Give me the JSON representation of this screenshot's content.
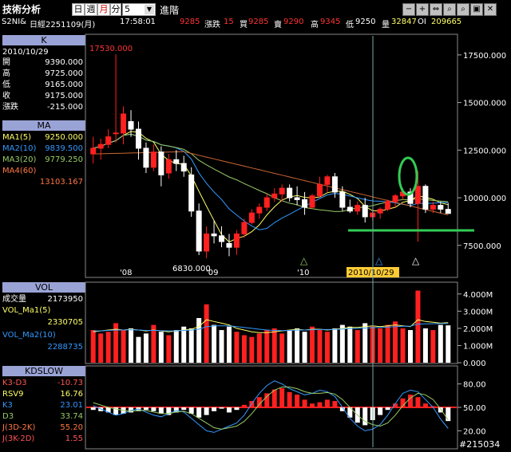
{
  "toolbar": {
    "title": "技術分析",
    "period_buttons": [
      "日",
      "週",
      "月",
      "分"
    ],
    "active_period": "月",
    "interval_value": "5",
    "advanced_label": "進階",
    "window_buttons": [
      "−",
      "+",
      "⇔",
      "⌕",
      "⌕",
      "▣",
      "✕"
    ]
  },
  "quote": {
    "symbol": "S2NI&",
    "name": "日經2251109(月)",
    "time": "17:58:01",
    "price": "9285",
    "change_label": "漲跌",
    "change_value": "15",
    "bid_label": "買",
    "bid_value": "9285",
    "ask_label": "賣",
    "ask_value": "9290",
    "high_label": "高",
    "high_value": "9345",
    "low_label": "低",
    "low_value": "9250",
    "volume_label": "量",
    "volume_value": "32847",
    "oi_label": "OI",
    "oi_value": "209665"
  },
  "k_panel": {
    "header": "K",
    "date": "2010/10/29",
    "rows": [
      {
        "label": "開",
        "value": "9390.000"
      },
      {
        "label": "高",
        "value": "9725.000"
      },
      {
        "label": "低",
        "value": "9165.000"
      },
      {
        "label": "收",
        "value": "9175.000"
      },
      {
        "label": "漲跌",
        "value": "-215.000"
      }
    ]
  },
  "ma_panel": {
    "header": "MA",
    "rows": [
      {
        "label": "MA1(5)",
        "value": "9250.000",
        "color": "#ffff66"
      },
      {
        "label": "MA2(10)",
        "value": "9839.500",
        "color": "#3399ff"
      },
      {
        "label": "MA3(20)",
        "value": "9779.250",
        "color": "#99cc66"
      },
      {
        "label": "MA4(60)",
        "value": "13103.167",
        "color": "#ff7744"
      }
    ]
  },
  "vol_panel": {
    "header": "VOL",
    "rows": [
      {
        "label": "成交量",
        "value": "2173950",
        "color": "#ffffff"
      },
      {
        "label": "VOL_Ma1(5)",
        "value": "2330705",
        "color": "#ffff66"
      },
      {
        "label": "VOL_Ma2(10)",
        "value": "2288735",
        "color": "#3399ff"
      }
    ]
  },
  "kd_panel": {
    "header": "KDSLOW",
    "rows": [
      {
        "label": "K3-D3",
        "value": "-10.73",
        "color": "#ff5555"
      },
      {
        "label": "RSV9",
        "value": "16.76",
        "color": "#ffff66"
      },
      {
        "label": "K3",
        "value": "23.01",
        "color": "#3399ff"
      },
      {
        "label": "D3",
        "value": "33.74",
        "color": "#99cc66"
      },
      {
        "label": "J(3D-2K)",
        "value": "55.20",
        "color": "#ff7744"
      },
      {
        "label": "J(3K-2D)",
        "value": "1.55",
        "color": "#ff5555"
      }
    ]
  },
  "chart_data": [
    {
      "type": "candlestick",
      "title": "",
      "y_ticks": [
        "17500.000",
        "15000.000",
        "12500.000",
        "10000.000",
        "7500.000"
      ],
      "ylim": [
        5900,
        18500
      ],
      "x_ticks": [
        "'08",
        "'09",
        "'10"
      ],
      "cursor_date": "2010/10/29",
      "annotations": {
        "high_marker": "17530.000",
        "low_marker": "6830.000"
      },
      "candles": [
        [
          12300,
          13200,
          11800,
          12600
        ],
        [
          12600,
          13100,
          12000,
          12800
        ],
        [
          12800,
          13600,
          12600,
          13200
        ],
        [
          13400,
          17530,
          12900,
          13400
        ],
        [
          13400,
          14800,
          12800,
          14400
        ],
        [
          14000,
          14600,
          13200,
          13600
        ],
        [
          13600,
          14000,
          12000,
          12600
        ],
        [
          12600,
          12900,
          11300,
          11600
        ],
        [
          11600,
          12800,
          11400,
          12400
        ],
        [
          12400,
          12700,
          10600,
          11200
        ],
        [
          11300,
          12300,
          11000,
          12000
        ],
        [
          12000,
          12500,
          11400,
          11800
        ],
        [
          11800,
          12200,
          11100,
          11400
        ],
        [
          11200,
          11600,
          9000,
          9300
        ],
        [
          9300,
          9700,
          6990,
          7200
        ],
        [
          7200,
          8500,
          6830,
          8100
        ],
        [
          8100,
          8800,
          7600,
          8000
        ],
        [
          8000,
          8500,
          7400,
          7700
        ],
        [
          7600,
          8100,
          6930,
          7400
        ],
        [
          7400,
          8300,
          7000,
          8100
        ],
        [
          8100,
          8900,
          7900,
          8700
        ],
        [
          8700,
          9400,
          8600,
          9200
        ],
        [
          9200,
          9700,
          8900,
          9500
        ],
        [
          9500,
          10200,
          9300,
          10000
        ],
        [
          10000,
          10500,
          9800,
          10200
        ],
        [
          10200,
          10700,
          9800,
          10500
        ],
        [
          10500,
          10700,
          9800,
          10000
        ],
        [
          10000,
          10600,
          9600,
          9900
        ],
        [
          9900,
          10300,
          9100,
          9500
        ],
        [
          9500,
          10200,
          9400,
          10100
        ],
        [
          10100,
          11100,
          10000,
          10700
        ],
        [
          10700,
          11200,
          10300,
          11100
        ],
        [
          11100,
          11300,
          10000,
          10300
        ],
        [
          10300,
          10600,
          9300,
          9500
        ],
        [
          9500,
          9900,
          9200,
          9300
        ],
        [
          9300,
          9800,
          9100,
          9600
        ],
        [
          9600,
          10000,
          8700,
          9000
        ],
        [
          9000,
          9400,
          8800,
          9200
        ],
        [
          9200,
          9500,
          8900,
          9400
        ],
        [
          9400,
          9900,
          9300,
          9800
        ],
        [
          9800,
          10200,
          9500,
          10100
        ],
        [
          10100,
          10500,
          9900,
          10300
        ],
        [
          10300,
          10500,
          9500,
          9700
        ],
        [
          9700,
          11400,
          7700,
          10600
        ],
        [
          10600,
          10700,
          9200,
          9400
        ],
        [
          9400,
          9800,
          9200,
          9600
        ],
        [
          9600,
          9800,
          9200,
          9400
        ],
        [
          9390,
          9725,
          9165,
          9175
        ]
      ],
      "marker_labels": [
        "△",
        "△",
        "△"
      ]
    },
    {
      "type": "bar",
      "title": "VOL",
      "y_ticks": [
        "4.000M",
        "3.000M",
        "2.000M",
        "1.000M",
        "0.000"
      ],
      "ylim": [
        0,
        4500000
      ],
      "values": [
        1900000,
        1700000,
        1800000,
        2300000,
        1900000,
        2000000,
        1500000,
        1700000,
        2200000,
        1800000,
        1600000,
        1900000,
        2100000,
        2000000,
        2600000,
        3400000,
        2200000,
        1900000,
        2100000,
        1800000,
        1600000,
        1500000,
        1700000,
        1900000,
        2000000,
        1700000,
        1900000,
        2000000,
        1800000,
        2100000,
        1900000,
        1800000,
        2000000,
        2200000,
        2100000,
        1900000,
        2300000,
        2100000,
        2000000,
        2200000,
        2400000,
        2000000,
        1900000,
        4200000,
        2000000,
        1900000,
        2200000,
        2173950
      ],
      "ma1": [
        1800000,
        1850000,
        1900000,
        1950000,
        1900000,
        1950000,
        1900000,
        1850000,
        1900000,
        1850000,
        1800000,
        1850000,
        1900000,
        1950000,
        2100000,
        2500000,
        2400000,
        2300000,
        2200000,
        2000000,
        1900000,
        1800000,
        1750000,
        1750000,
        1800000,
        1850000,
        1900000,
        1950000,
        1900000,
        1950000,
        1950000,
        1900000,
        1950000,
        2000000,
        2050000,
        2050000,
        2100000,
        2150000,
        2100000,
        2150000,
        2200000,
        2150000,
        2100000,
        2500000,
        2400000,
        2350000,
        2300000,
        2330705
      ],
      "ma2": [
        1850000,
        1850000,
        1880000,
        1900000,
        1900000,
        1920000,
        1900000,
        1880000,
        1880000,
        1870000,
        1850000,
        1850000,
        1880000,
        1900000,
        1950000,
        2100000,
        2150000,
        2150000,
        2150000,
        2100000,
        2050000,
        2000000,
        1950000,
        1900000,
        1880000,
        1870000,
        1880000,
        1900000,
        1900000,
        1920000,
        1930000,
        1930000,
        1940000,
        1960000,
        1990000,
        2000000,
        2020000,
        2040000,
        2050000,
        2070000,
        2100000,
        2120000,
        2130000,
        2250000,
        2260000,
        2270000,
        2280000,
        2288735
      ]
    },
    {
      "type": "bar",
      "title": "KDSLOW",
      "y_ticks": [
        "80.00",
        "50.00",
        "20.00"
      ],
      "ylim": [
        0,
        100
      ],
      "diff": [
        -2,
        -3,
        -4,
        -6,
        -5,
        -4,
        -3,
        -2,
        -3,
        -5,
        -6,
        -4,
        -2,
        -5,
        -8,
        -6,
        -3,
        -1,
        -4,
        -2,
        2,
        5,
        8,
        11,
        14,
        15,
        12,
        10,
        6,
        3,
        4,
        6,
        5,
        -3,
        -8,
        -12,
        -14,
        -10,
        -6,
        -2,
        3,
        7,
        10,
        8,
        3,
        1,
        -4,
        -10.73
      ],
      "k": [
        52,
        48,
        44,
        40,
        42,
        46,
        48,
        44,
        40,
        38,
        42,
        46,
        44,
        36,
        28,
        20,
        18,
        22,
        26,
        30,
        40,
        55,
        68,
        78,
        84,
        80,
        74,
        70,
        66,
        68,
        72,
        70,
        64,
        50,
        36,
        26,
        20,
        22,
        28,
        40,
        55,
        68,
        72,
        70,
        60,
        50,
        35,
        23.01
      ],
      "d": [
        56,
        53,
        50,
        48,
        46,
        45,
        46,
        46,
        44,
        42,
        42,
        44,
        45,
        42,
        36,
        30,
        24,
        22,
        24,
        26,
        32,
        42,
        54,
        64,
        72,
        76,
        76,
        74,
        70,
        68,
        68,
        69,
        67,
        60,
        50,
        40,
        32,
        28,
        26,
        30,
        40,
        52,
        62,
        68,
        66,
        60,
        48,
        33.74
      ]
    }
  ],
  "watermark": "#215034"
}
